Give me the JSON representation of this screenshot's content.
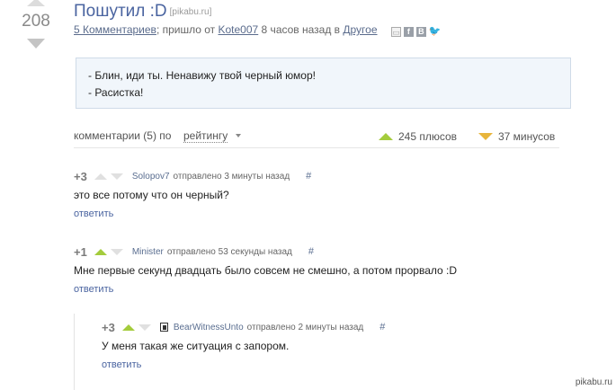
{
  "post": {
    "rating": "208",
    "title": "Пошутил :D",
    "source": "[pikabu.ru]",
    "comments_link": "5 Комментариев",
    "meta_text_1": "; пришло от ",
    "author": "Kote007",
    "meta_text_2": " 8 часов назад в ",
    "category": "Другое",
    "quote_lines": [
      "- Блин, иди ты. Ненавижу твой черный юмор!",
      "- Расистка!"
    ]
  },
  "sort_bar": {
    "label": "комментарии (5) по",
    "sort_value": "рейтингу",
    "plus_text": "245 плюсов",
    "minus_text": "37 минусов"
  },
  "comments": [
    {
      "score": "+3",
      "author": "Solopov7",
      "time": "отправлено 3 минуты назад",
      "hash": "#",
      "text": "это все потому что он черный?",
      "reply": "ответить"
    },
    {
      "score": "+1",
      "author": "Minister",
      "time": "отправлено 53 секунды назад",
      "hash": "#",
      "text": "Мне первые секунд двадцать было совсем не смешно, а потом прорвало :D",
      "reply": "ответить"
    },
    {
      "score": "+3",
      "author": "BearWitnessUnto",
      "time": "отправлено 2 минуты назад",
      "hash": "#",
      "text": "У меня такая же ситуация с запором.",
      "reply": "ответить"
    }
  ],
  "watermark": "pikabu.ru",
  "icons": {
    "save": "save-icon",
    "facebook": "facebook-icon",
    "vk": "vk-icon",
    "twitter": "twitter-icon"
  },
  "colors": {
    "link": "#4a64a0",
    "plus": "#a4cc3c",
    "minus": "#e8b53b",
    "quote_bg": "#f1f6fb"
  }
}
